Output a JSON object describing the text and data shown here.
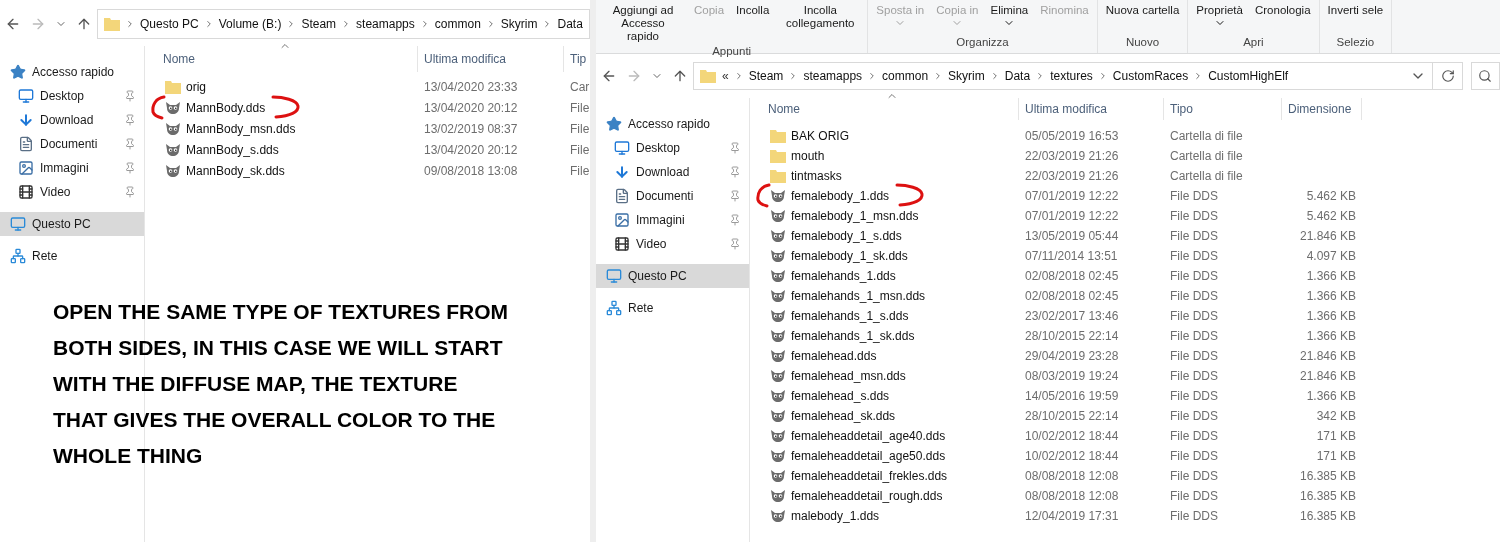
{
  "left_window": {
    "breadcrumb": [
      "Questo PC",
      "Volume (B:)",
      "Steam",
      "steamapps",
      "common",
      "Skyrim",
      "Data"
    ],
    "sidebar": [
      {
        "kind": "star",
        "label": "Accesso rapido",
        "pinned": false,
        "selected": false
      },
      {
        "kind": "desktop",
        "label": "Desktop",
        "pinned": true,
        "selected": false
      },
      {
        "kind": "download",
        "label": "Download",
        "pinned": true,
        "selected": false
      },
      {
        "kind": "document",
        "label": "Documenti",
        "pinned": true,
        "selected": false
      },
      {
        "kind": "images",
        "label": "Immagini",
        "pinned": true,
        "selected": false
      },
      {
        "kind": "video",
        "label": "Video",
        "pinned": true,
        "selected": false
      },
      {
        "kind": "pc",
        "label": "Questo PC",
        "pinned": false,
        "selected": true
      },
      {
        "kind": "network",
        "label": "Rete",
        "pinned": false,
        "selected": false
      }
    ],
    "columns": [
      "Nome",
      "Ultima modifica",
      "Tip"
    ],
    "rows": [
      {
        "kind": "folder",
        "name": "orig",
        "modified": "13/04/2020 23:33",
        "type": "Car",
        "circled": false
      },
      {
        "kind": "image",
        "name": "MannBody.dds",
        "modified": "13/04/2020 20:12",
        "type": "File",
        "circled": true
      },
      {
        "kind": "image",
        "name": "MannBody_msn.dds",
        "modified": "13/02/2019 08:37",
        "type": "File",
        "circled": false
      },
      {
        "kind": "image",
        "name": "MannBody_s.dds",
        "modified": "13/04/2020 20:12",
        "type": "File",
        "circled": false
      },
      {
        "kind": "image",
        "name": "MannBody_sk.dds",
        "modified": "09/08/2018 13:08",
        "type": "File",
        "circled": false
      }
    ]
  },
  "annotation": {
    "lines": [
      "OPEN THE SAME TYPE OF TEXTURES FROM",
      "BOTH SIDES, IN THIS CASE WE WILL START",
      "WITH THE DIFFUSE MAP, THE TEXTURE",
      "THAT GIVES THE OVERALL COLOR TO THE",
      "WHOLE THING"
    ]
  },
  "right_window": {
    "ribbon": [
      {
        "label": "Appunti",
        "commands": [
          {
            "label": "Aggiungi ad Accesso rapido",
            "disabled": false,
            "caret": false
          },
          {
            "label": "Copia",
            "disabled": true,
            "caret": false
          },
          {
            "label": "Incolla",
            "disabled": false,
            "caret": false
          },
          {
            "label": "Incolla collegamento",
            "disabled": false,
            "caret": false
          }
        ]
      },
      {
        "label": "Organizza",
        "commands": [
          {
            "label": "Sposta in",
            "disabled": true,
            "caret": true
          },
          {
            "label": "Copia in",
            "disabled": true,
            "caret": true
          },
          {
            "label": "Elimina",
            "disabled": false,
            "caret": true
          },
          {
            "label": "Rinomina",
            "disabled": true,
            "caret": false
          }
        ]
      },
      {
        "label": "Nuovo",
        "commands": [
          {
            "label": "Nuova cartella",
            "disabled": false,
            "caret": false
          }
        ]
      },
      {
        "label": "Apri",
        "commands": [
          {
            "label": "Proprietà",
            "disabled": false,
            "caret": true
          },
          {
            "label": "Cronologia",
            "disabled": false,
            "caret": false
          }
        ]
      },
      {
        "label": "Selezio",
        "commands": [
          {
            "label": "Inverti sele",
            "disabled": false,
            "caret": false
          }
        ]
      }
    ],
    "overflow_marker": "«",
    "breadcrumb": [
      "Steam",
      "steamapps",
      "common",
      "Skyrim",
      "Data",
      "textures",
      "CustomRaces",
      "CustomHighElf"
    ],
    "sidebar": [
      {
        "kind": "star",
        "label": "Accesso rapido",
        "pinned": false,
        "selected": false
      },
      {
        "kind": "desktop",
        "label": "Desktop",
        "pinned": true,
        "selected": false
      },
      {
        "kind": "download",
        "label": "Download",
        "pinned": true,
        "selected": false
      },
      {
        "kind": "document",
        "label": "Documenti",
        "pinned": true,
        "selected": false
      },
      {
        "kind": "images",
        "label": "Immagini",
        "pinned": true,
        "selected": false
      },
      {
        "kind": "video",
        "label": "Video",
        "pinned": true,
        "selected": false
      },
      {
        "kind": "pc",
        "label": "Questo PC",
        "pinned": false,
        "selected": true
      },
      {
        "kind": "network",
        "label": "Rete",
        "pinned": false,
        "selected": false
      }
    ],
    "columns": [
      "Nome",
      "Ultima modifica",
      "Tipo",
      "Dimensione"
    ],
    "rows": [
      {
        "kind": "folder",
        "name": "BAK ORIG",
        "modified": "05/05/2019 16:53",
        "type": "Cartella di file",
        "size": "",
        "circled": false
      },
      {
        "kind": "folder",
        "name": "mouth",
        "modified": "22/03/2019 21:26",
        "type": "Cartella di file",
        "circled": false
      },
      {
        "kind": "folder",
        "name": "tintmasks",
        "modified": "22/03/2019 21:26",
        "type": "Cartella di file",
        "circled": false
      },
      {
        "kind": "image",
        "name": "femalebody_1.dds",
        "modified": "07/01/2019 12:22",
        "type": "File DDS",
        "size": "5.462 KB",
        "circled": true
      },
      {
        "kind": "image",
        "name": "femalebody_1_msn.dds",
        "modified": "07/01/2019 12:22",
        "type": "File DDS",
        "size": "5.462 KB",
        "circled": false
      },
      {
        "kind": "image",
        "name": "femalebody_1_s.dds",
        "modified": "13/05/2019 05:44",
        "type": "File DDS",
        "size": "21.846 KB",
        "circled": false
      },
      {
        "kind": "image",
        "name": "femalebody_1_sk.dds",
        "modified": "07/11/2014 13:51",
        "type": "File DDS",
        "size": "4.097 KB",
        "circled": false
      },
      {
        "kind": "image",
        "name": "femalehands_1.dds",
        "modified": "02/08/2018 02:45",
        "type": "File DDS",
        "size": "1.366 KB",
        "circled": false
      },
      {
        "kind": "image",
        "name": "femalehands_1_msn.dds",
        "modified": "02/08/2018 02:45",
        "type": "File DDS",
        "size": "1.366 KB",
        "circled": false
      },
      {
        "kind": "image",
        "name": "femalehands_1_s.dds",
        "modified": "23/02/2017 13:46",
        "type": "File DDS",
        "size": "1.366 KB",
        "circled": false
      },
      {
        "kind": "image",
        "name": "femalehands_1_sk.dds",
        "modified": "28/10/2015 22:14",
        "type": "File DDS",
        "size": "1.366 KB",
        "circled": false
      },
      {
        "kind": "image",
        "name": "femalehead.dds",
        "modified": "29/04/2019 23:28",
        "type": "File DDS",
        "size": "21.846 KB",
        "circled": false
      },
      {
        "kind": "image",
        "name": "femalehead_msn.dds",
        "modified": "08/03/2019 19:24",
        "type": "File DDS",
        "size": "21.846 KB",
        "circled": false
      },
      {
        "kind": "image",
        "name": "femalehead_s.dds",
        "modified": "14/05/2016 19:59",
        "type": "File DDS",
        "size": "1.366 KB",
        "circled": false
      },
      {
        "kind": "image",
        "name": "femalehead_sk.dds",
        "modified": "28/10/2015 22:14",
        "type": "File DDS",
        "size": "342 KB",
        "circled": false
      },
      {
        "kind": "image",
        "name": "femaleheaddetail_age40.dds",
        "modified": "10/02/2012 18:44",
        "type": "File DDS",
        "size": "171 KB",
        "circled": false
      },
      {
        "kind": "image",
        "name": "femaleheaddetail_age50.dds",
        "modified": "10/02/2012 18:44",
        "type": "File DDS",
        "size": "171 KB",
        "circled": false
      },
      {
        "kind": "image",
        "name": "femaleheaddetail_frekles.dds",
        "modified": "08/08/2018 12:08",
        "type": "File DDS",
        "size": "16.385 KB",
        "circled": false
      },
      {
        "kind": "image",
        "name": "femaleheaddetail_rough.dds",
        "modified": "08/08/2018 12:08",
        "type": "File DDS",
        "size": "16.385 KB",
        "circled": false
      },
      {
        "kind": "image",
        "name": "malebody_1.dds",
        "modified": "12/04/2019 17:31",
        "type": "File DDS",
        "size": "16.385 KB",
        "circled": false
      }
    ]
  }
}
